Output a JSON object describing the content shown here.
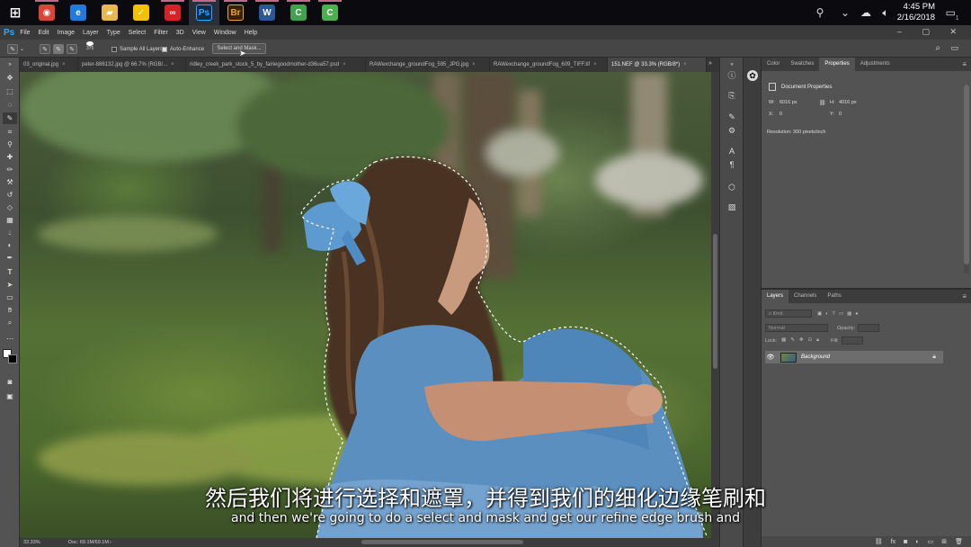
{
  "taskbar": {
    "apps": [
      {
        "name": "windows-start",
        "glyph": "⊞",
        "color": "#0a0a0f",
        "open": false
      },
      {
        "name": "chrome",
        "glyph": "◉",
        "color": "#db4437",
        "open": true
      },
      {
        "name": "edge",
        "glyph": "e",
        "color": "#1e7be0",
        "open": false
      },
      {
        "name": "file-explorer",
        "glyph": "▰",
        "color": "#e8b94a",
        "open": false
      },
      {
        "name": "norton",
        "glyph": "✓",
        "color": "#f2c200",
        "open": false
      },
      {
        "name": "creative-cloud",
        "glyph": "∞",
        "color": "#da1f26",
        "open": true
      },
      {
        "name": "photoshop",
        "glyph": "Ps",
        "color": "#0c2a4a",
        "open": true
      },
      {
        "name": "bridge",
        "glyph": "Br",
        "color": "#3a2200",
        "open": true
      },
      {
        "name": "word",
        "glyph": "W",
        "color": "#2b579a",
        "open": true
      },
      {
        "name": "camtasia",
        "glyph": "C",
        "color": "#3fa34d",
        "open": true
      },
      {
        "name": "camtasia-recorder",
        "glyph": "C",
        "color": "#4caf50",
        "open": true
      }
    ],
    "clock": {
      "time": "4:45 PM",
      "date": "2/16/2018"
    },
    "notification_count": "1"
  },
  "menubar": {
    "logo": "Ps",
    "items": [
      "File",
      "Edit",
      "Image",
      "Layer",
      "Type",
      "Select",
      "Filter",
      "3D",
      "View",
      "Window",
      "Help"
    ]
  },
  "options": {
    "brush_size": "375",
    "sample_all_layers": "Sample All Layers",
    "auto_enhance": "Auto-Enhance",
    "select_and_mask": "Select and Mask..."
  },
  "tabs": [
    {
      "label": "03_original.jpg",
      "active": false
    },
    {
      "label": "peter-886132.jpg @ 66.7% (RGB/...",
      "active": false
    },
    {
      "label": "ridley_creek_park_stock_5_by_fairiegoodmother-d36ua57.psd",
      "active": false
    },
    {
      "label": "RAWexchange_groundFog_595_JPG.jpg",
      "active": false
    },
    {
      "label": "RAWexchange_groundFog_609_TIFF.tif",
      "active": false
    },
    {
      "label": "151.NEF @ 33.3% (RGB/8*)",
      "active": true
    }
  ],
  "status": {
    "zoom": "33.33%",
    "doc": "Doc: 69.1M/69.1M"
  },
  "properties": {
    "tabs": [
      "Color",
      "Swatches",
      "Properties",
      "Adjustments"
    ],
    "active_tab": "Properties",
    "title": "Document Properties",
    "w_label": "W:",
    "w_value": "6016 px",
    "h_label": "H:",
    "h_value": "4016 px",
    "x_label": "X:",
    "x_value": "0",
    "y_label": "Y:",
    "y_value": "0",
    "resolution": "Resolution: 300 pixels/inch"
  },
  "layers": {
    "tabs": [
      "Layers",
      "Channels",
      "Paths"
    ],
    "active_tab": "Layers",
    "kind": "Kind",
    "blend": "Normal",
    "opacity_label": "Opacity:",
    "lock_label": "Lock:",
    "fill_label": "Fill:",
    "layer_name": "Background"
  },
  "subtitles": {
    "cn": "然后我们将进行选择和遮罩，并得到我们的细化边缘笔刷和",
    "en": "and then we're going to do a select and mask and get our refine edge brush and"
  }
}
